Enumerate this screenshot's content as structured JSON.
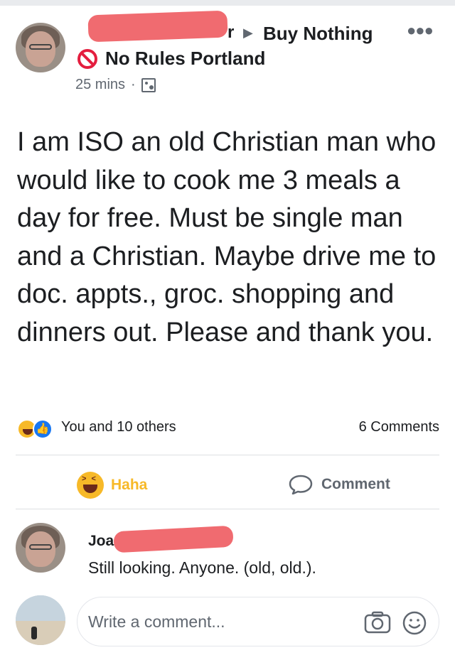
{
  "post": {
    "poster_trail": "r",
    "group_name_line1": "Buy Nothing",
    "group_name_line2": "No Rules Portland",
    "timestamp": "25 mins",
    "separator": "·",
    "body": "I am ISO an old Christian man who would like to cook me 3 meals a day for free. Must be single man and a Christian. Maybe drive me to doc. appts., groc. shopping and dinners out. Please and thank you."
  },
  "reactions": {
    "summary": "You and 10 others",
    "comment_count": "6 Comments",
    "icons": [
      "haha-icon",
      "like-icon"
    ]
  },
  "actions": {
    "haha_label": "Haha",
    "comment_label": "Comment"
  },
  "comment": {
    "author_visible": "Joa",
    "text": "Still looking. Anyone. (old, old.)."
  },
  "compose": {
    "placeholder": "Write a comment..."
  },
  "colors": {
    "haha": "#f7b928",
    "like": "#1877f2",
    "redaction": "#f06b70",
    "secondary_text": "#606770"
  }
}
